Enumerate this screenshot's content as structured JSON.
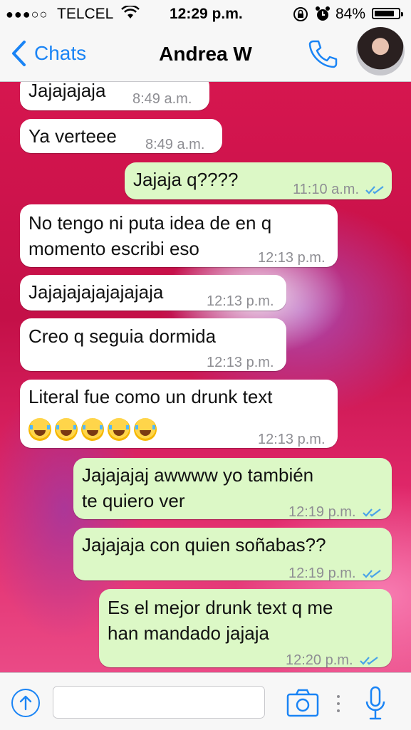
{
  "status_bar": {
    "signal": "●●●○○",
    "carrier": "TELCEL",
    "time": "12:29 p.m.",
    "battery": "84%",
    "battery_level": 0.84
  },
  "nav": {
    "back_label": "Chats",
    "title": "Andrea W"
  },
  "messages": [
    {
      "dir": "in",
      "lines": [
        "Jajajajaja"
      ],
      "time": "8:49 a.m."
    },
    {
      "dir": "in",
      "lines": [
        "Ya verteee"
      ],
      "time": "8:49 a.m."
    },
    {
      "dir": "out",
      "lines": [
        "Jajaja q????"
      ],
      "time": "11:10 a.m.",
      "read": true
    },
    {
      "dir": "in",
      "lines": [
        "No tengo ni puta idea de en q",
        "momento escribi eso"
      ],
      "time": "12:13 p.m."
    },
    {
      "dir": "in",
      "lines": [
        "Jajajajajajajajaja"
      ],
      "time": "12:13 p.m."
    },
    {
      "dir": "in",
      "lines": [
        "Creo q seguia dormida"
      ],
      "time": "12:13 p.m."
    },
    {
      "dir": "in",
      "lines": [
        "Literal fue como un drunk text"
      ],
      "emoji_count": 5,
      "emoji": "face-with-tears-of-joy-icon",
      "time": "12:13 p.m."
    },
    {
      "dir": "out",
      "lines": [
        "Jajajajaj awwww yo también",
        "te quiero ver"
      ],
      "time": "12:19 p.m.",
      "read": true
    },
    {
      "dir": "out",
      "lines": [
        "Jajajaja con quien soñabas??"
      ],
      "time": "12:19 p.m.",
      "read": true
    },
    {
      "dir": "out",
      "lines": [
        "Es el mejor drunk text q me",
        "han mandado jajaja"
      ],
      "time": "12:20 p.m.",
      "read": true
    }
  ],
  "colors": {
    "accent": "#1a84f5",
    "outgoing_bubble": "#dcf8c6",
    "incoming_bubble": "#ffffff",
    "read_ticks": "#4aa3e8"
  }
}
